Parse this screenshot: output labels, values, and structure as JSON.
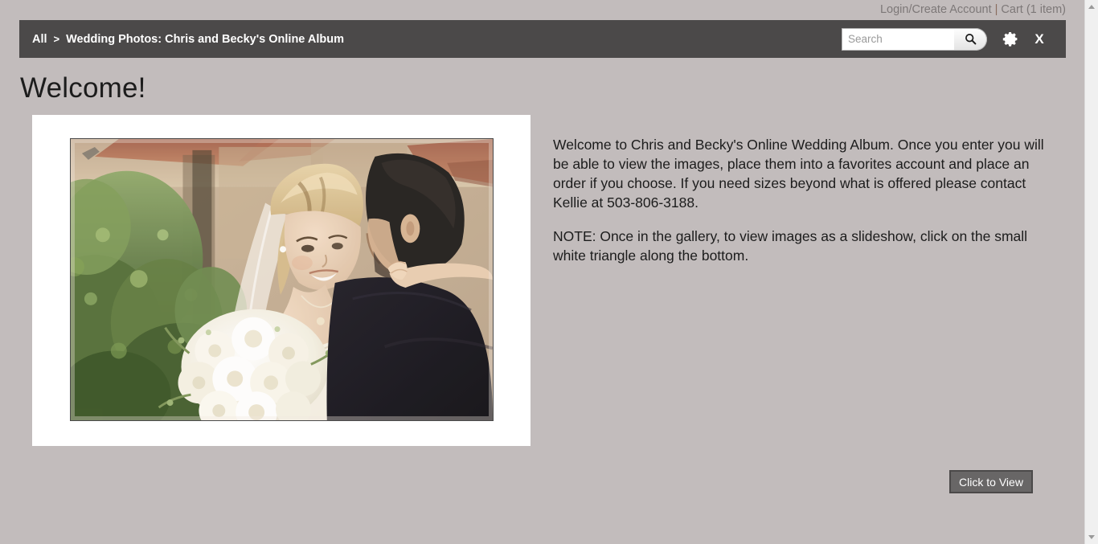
{
  "top_bar": {
    "login_label": "Login/Create Account",
    "separator": "|",
    "cart_label": "Cart (1 item)"
  },
  "nav_header": {
    "breadcrumb": {
      "root_label": "All",
      "separator": ">",
      "current_label": "Wedding Photos: Chris and Becky's Online Album"
    },
    "search": {
      "value": "",
      "placeholder": "Search",
      "button_icon": "search-icon"
    },
    "settings_icon": "gear-icon",
    "close_icon": "close-icon",
    "close_label": "X"
  },
  "main": {
    "page_title": "Welcome!",
    "photo": {
      "alt": "Bride holding white rose bouquet embracing groom outdoors"
    },
    "paragraphs": [
      "Welcome to Chris and Becky's Online Wedding Album. Once you enter you will be able to view the images, place them into a favorites account and place an order if you choose. If you need sizes beyond what is offered please contact Kellie at 503-806-3188.",
      "NOTE: Once in the gallery, to view images as a slideshow, click on the small white triangle along the bottom."
    ],
    "cta_button_label": "Click to View"
  },
  "scrollbar": {
    "up_icon": "chevron-up-icon",
    "down_icon": "chevron-down-icon"
  },
  "colors": {
    "page_background": "#c2bcbc",
    "header_bar": "#4b4949",
    "header_text": "#ffffff",
    "top_bar_text": "#7d7878",
    "separator": "#8a6d5f",
    "button_face": "#686666",
    "button_border": "#4b4949",
    "card_background": "#ffffff",
    "body_text": "#1c1c1c"
  }
}
